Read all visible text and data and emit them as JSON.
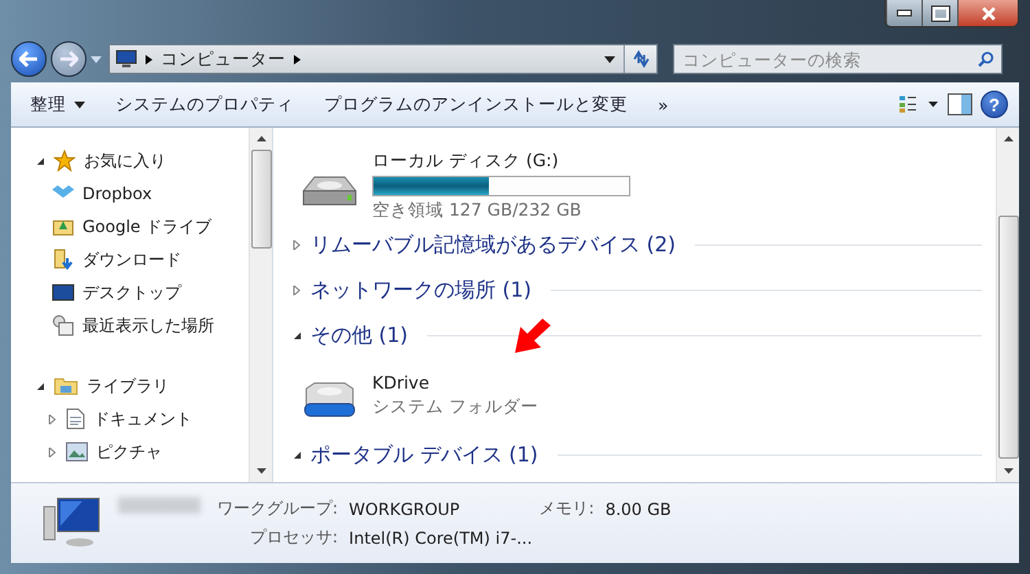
{
  "address_bar": {
    "path": [
      "コンピューター"
    ]
  },
  "search": {
    "placeholder": "コンピューターの検索"
  },
  "toolbar": {
    "items": [
      {
        "label": "整理",
        "dropdown": true
      },
      {
        "label": "システムのプロパティ",
        "dropdown": false
      },
      {
        "label": "プログラムのアンインストールと変更",
        "dropdown": false
      }
    ],
    "overflow": "»",
    "help": "?"
  },
  "sidebar": {
    "groups": [
      {
        "label": "お気に入り",
        "expanded": true,
        "children": [
          {
            "label": "Dropbox"
          },
          {
            "label": "Google ドライブ"
          },
          {
            "label": "ダウンロード"
          },
          {
            "label": "デスクトップ"
          },
          {
            "label": "最近表示した場所"
          }
        ]
      },
      {
        "label": "ライブラリ",
        "expanded": true,
        "children": [
          {
            "label": "ドキュメント",
            "expanded": false
          },
          {
            "label": "ピクチャ",
            "expanded": false
          }
        ]
      }
    ]
  },
  "content": {
    "drive": {
      "name": "ローカル ディスク (G:)",
      "level": 0.45,
      "free": "空き領域 127 GB/232 GB"
    },
    "groups": [
      {
        "title": "リムーバブル記憶域があるデバイス (2)",
        "expanded": false
      },
      {
        "title": "ネットワークの場所 (1)",
        "expanded": false
      },
      {
        "title": "その他 (1)",
        "expanded": true,
        "items": [
          {
            "name": "KDrive",
            "type": "システム フォルダー"
          }
        ]
      },
      {
        "title": "ポータブル デバイス (1)",
        "expanded": true
      }
    ]
  },
  "details": {
    "fields": [
      {
        "label": "ワークグループ:",
        "value": "WORKGROUP"
      },
      {
        "label": "メモリ:",
        "value": "8.00 GB"
      },
      {
        "label": "プロセッサ:",
        "value": "Intel(R) Core(TM) i7-..."
      }
    ]
  }
}
